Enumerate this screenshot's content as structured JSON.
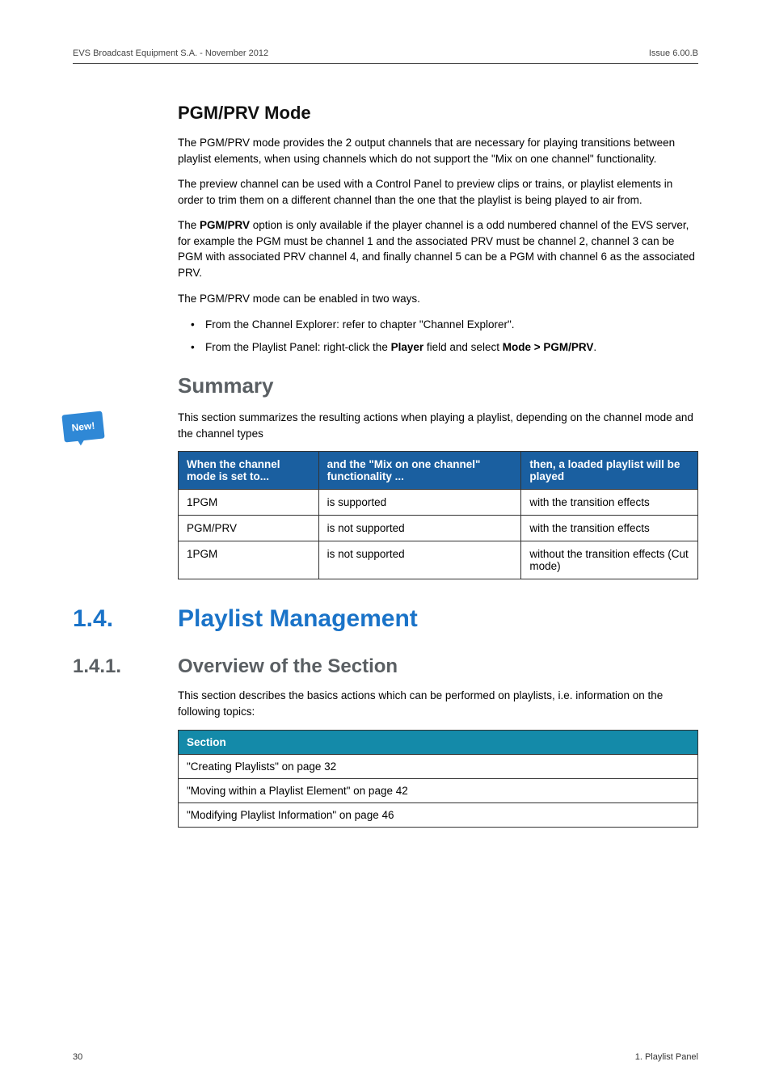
{
  "header": {
    "left": "EVS Broadcast Equipment S.A. - November 2012",
    "right": "Issue 6.00.B"
  },
  "pgmprv": {
    "heading": "PGM/PRV Mode",
    "p1": "The PGM/PRV mode provides the 2 output channels that are necessary for playing transitions between playlist elements, when using channels which do not support the \"Mix on one channel\" functionality.",
    "p2": "The preview channel can be used with a Control Panel to preview clips or trains, or playlist elements in order to trim them on a different channel than the one that the playlist is being played to air from.",
    "p3_a": "The ",
    "p3_b": "PGM/PRV",
    "p3_c": " option is only available if the player channel is a odd numbered channel of the EVS server, for example the PGM must be channel 1 and the associated PRV must be channel 2, channel 3 can be PGM with associated PRV channel 4, and finally channel 5 can be a PGM with channel 6 as the associated PRV.",
    "p4": "The PGM/PRV mode can be enabled in two ways.",
    "li1": "From the Channel Explorer: refer to chapter \"Channel Explorer\".",
    "li2_a": "From the Playlist Panel: right-click the ",
    "li2_b": "Player",
    "li2_c": " field and select ",
    "li2_d": "Mode > PGM/PRV",
    "li2_e": "."
  },
  "summary": {
    "heading": "Summary",
    "badge": "New!",
    "intro": "This section summarizes the resulting actions when playing a playlist, depending on the channel mode and the channel types",
    "th1": "When the channel mode is set to...",
    "th2": "and the \"Mix on one channel\" functionality ...",
    "th3": "then, a loaded playlist will be played",
    "rows": [
      {
        "c1": "1PGM",
        "c2": "is supported",
        "c3": "with the transition effects"
      },
      {
        "c1": "PGM/PRV",
        "c2": "is not supported",
        "c3": "with the transition effects"
      },
      {
        "c1": "1PGM",
        "c2": "is not supported",
        "c3": "without the transition effects (Cut mode)"
      }
    ]
  },
  "chapter": {
    "num": "1.4.",
    "title": "Playlist Management"
  },
  "section": {
    "num": "1.4.1.",
    "title": "Overview of the Section"
  },
  "overview": {
    "p1": "This section describes the basics actions which can be performed on playlists, i.e. information on the following topics:",
    "th": "Section",
    "rows": [
      "\"Creating Playlists\" on page 32",
      "\"Moving within a Playlist Element\" on page 42",
      "\"Modifying Playlist Information\" on page 46"
    ]
  },
  "footer": {
    "left": "30",
    "right": "1. Playlist Panel"
  }
}
